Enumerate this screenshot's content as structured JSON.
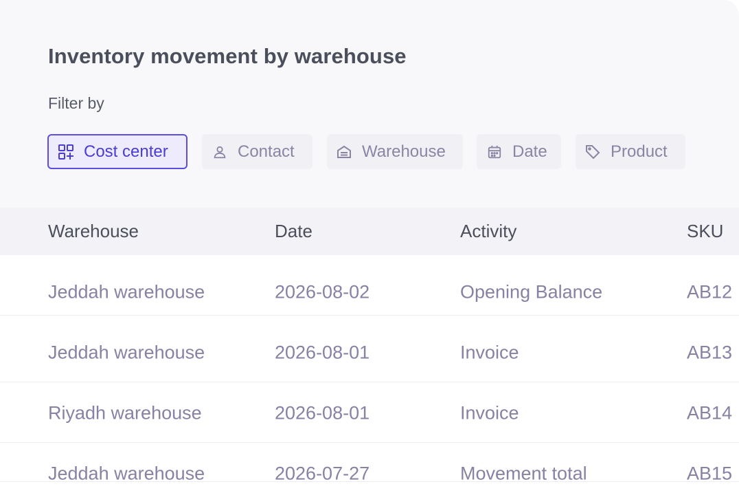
{
  "header": {
    "title": "Inventory movement by warehouse",
    "filter_label": "Filter by"
  },
  "filters": [
    {
      "label": "Cost center",
      "icon": "qr-grid-icon",
      "active": true
    },
    {
      "label": "Contact",
      "icon": "person-icon",
      "active": false
    },
    {
      "label": "Warehouse",
      "icon": "warehouse-icon",
      "active": false
    },
    {
      "label": "Date",
      "icon": "calendar-icon",
      "active": false
    },
    {
      "label": "Product",
      "icon": "tag-icon",
      "active": false
    }
  ],
  "table": {
    "columns": [
      "Warehouse",
      "Date",
      "Activity",
      "SKU"
    ],
    "rows": [
      [
        "Jeddah warehouse",
        "2026-08-02",
        "Opening Balance",
        "AB12"
      ],
      [
        "Jeddah warehouse",
        "2026-08-01",
        "Invoice",
        "AB13"
      ],
      [
        "Riyadh warehouse",
        "2026-08-01",
        "Invoice",
        "AB14"
      ],
      [
        "Jeddah warehouse",
        "2026-07-27",
        "Movement total",
        "AB15"
      ]
    ]
  },
  "colors": {
    "accent": "#5b4de0",
    "accent_bg": "#eeecfc",
    "chip_bg": "#f0f0f5",
    "muted_text": "#8981a4",
    "heading_text": "#4b4f5c"
  }
}
